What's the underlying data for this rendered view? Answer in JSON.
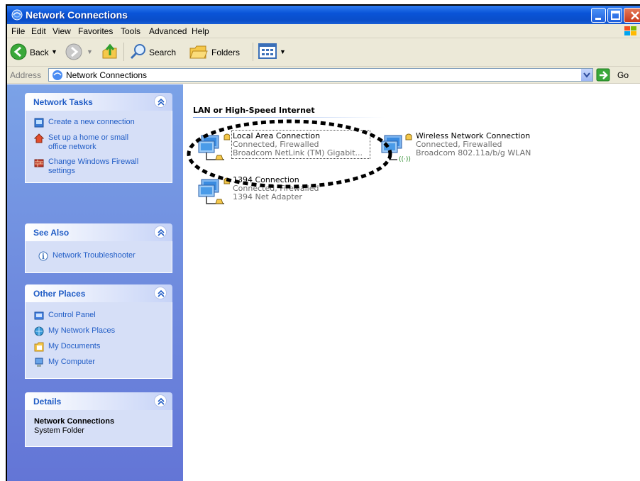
{
  "window": {
    "title": "Network Connections",
    "colors": {
      "titlebar": "#0a54d8",
      "taskpane": "#6f8ee0",
      "link": "#215dc6"
    }
  },
  "menu": [
    "File",
    "Edit",
    "View",
    "Favorites",
    "Tools",
    "Advanced",
    "Help"
  ],
  "toolbar": {
    "back": "Back",
    "search": "Search",
    "folders": "Folders"
  },
  "address": {
    "label": "Address",
    "value": "Network Connections",
    "go": "Go"
  },
  "sidebar": {
    "network_tasks": {
      "title": "Network Tasks",
      "items": [
        {
          "label_lines": [
            "Create a new connection"
          ],
          "icon": "new-connection-icon"
        },
        {
          "label_lines": [
            "Set up a home or small",
            "office network"
          ],
          "icon": "home-network-icon"
        },
        {
          "label_lines": [
            "Change Windows Firewall",
            "settings"
          ],
          "icon": "firewall-icon"
        }
      ]
    },
    "see_also": {
      "title": "See Also",
      "items": [
        {
          "label": "Network Troubleshooter",
          "icon": "info-icon"
        }
      ]
    },
    "other_places": {
      "title": "Other Places",
      "items": [
        {
          "label": "Control Panel",
          "icon": "control-panel-icon"
        },
        {
          "label": "My Network Places",
          "icon": "network-places-icon"
        },
        {
          "label": "My Documents",
          "icon": "documents-icon"
        },
        {
          "label": "My Computer",
          "icon": "computer-icon"
        }
      ]
    },
    "details": {
      "title": "Details",
      "name": "Network Connections",
      "type": "System Folder"
    }
  },
  "content": {
    "group_header": "LAN or High-Speed Internet",
    "connections": [
      {
        "name": "Local Area Connection",
        "status": "Connected, Firewalled",
        "device": "Broadcom NetLink (TM) Gigabit...",
        "icon": "lan-icon"
      },
      {
        "name": "Wireless Network Connection",
        "status": "Connected, Firewalled",
        "device": "Broadcom 802.11a/b/g WLAN",
        "icon": "wireless-icon"
      },
      {
        "name": "1394 Connection",
        "status": "Connected, Firewalled",
        "device": "1394 Net Adapter",
        "icon": "lan-icon"
      }
    ]
  }
}
